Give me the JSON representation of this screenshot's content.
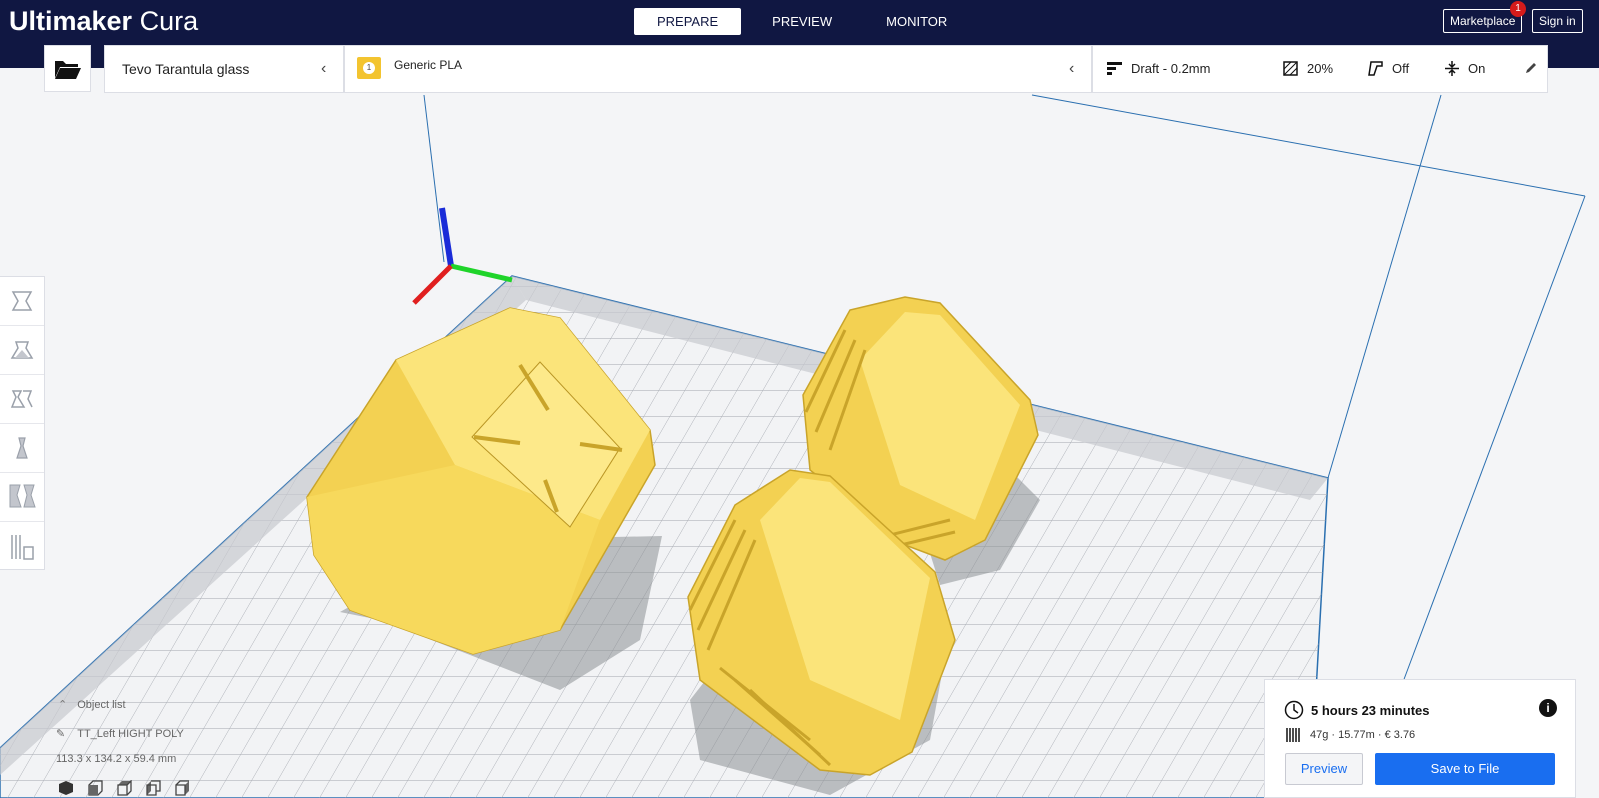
{
  "app": {
    "logo_bold": "Ultimaker",
    "logo_light": " Cura"
  },
  "stages": [
    {
      "label": "PREPARE",
      "active": true
    },
    {
      "label": "PREVIEW",
      "active": false
    },
    {
      "label": "MONITOR",
      "active": false
    }
  ],
  "header_buttons": {
    "marketplace": "Marketplace",
    "marketplace_badge": "1",
    "sign_in": "Sign in"
  },
  "printer": {
    "name": "Tevo Tarantula glass"
  },
  "material": {
    "extruder": "1",
    "name": "Generic PLA"
  },
  "print_settings": {
    "profile": "Draft - 0.2mm",
    "infill": "20%",
    "support": "Off",
    "adhesion": "On"
  },
  "object_list": {
    "title": "Object list",
    "object_name": "TT_Left HIGHT POLY",
    "dimensions": "113.3 x 134.2 x 59.4 mm"
  },
  "output": {
    "time": "5 hours 23 minutes",
    "material": "47g · 15.77m · € 3.76",
    "preview_label": "Preview",
    "save_label": "Save to File"
  },
  "colors": {
    "header": "#101742",
    "accent": "#196ef0",
    "model": "#f8e06a",
    "badge": "#d41b1b"
  },
  "icons": [
    "folder-open-icon",
    "chevron-left-icon",
    "profile-icon",
    "infill-icon",
    "support-icon",
    "adhesion-icon",
    "pencil-icon",
    "clock-icon",
    "filament-icon",
    "info-icon",
    "move-icon",
    "scale-icon",
    "rotate-icon",
    "mirror-icon",
    "per-model-settings-icon",
    "support-blocker-icon"
  ]
}
